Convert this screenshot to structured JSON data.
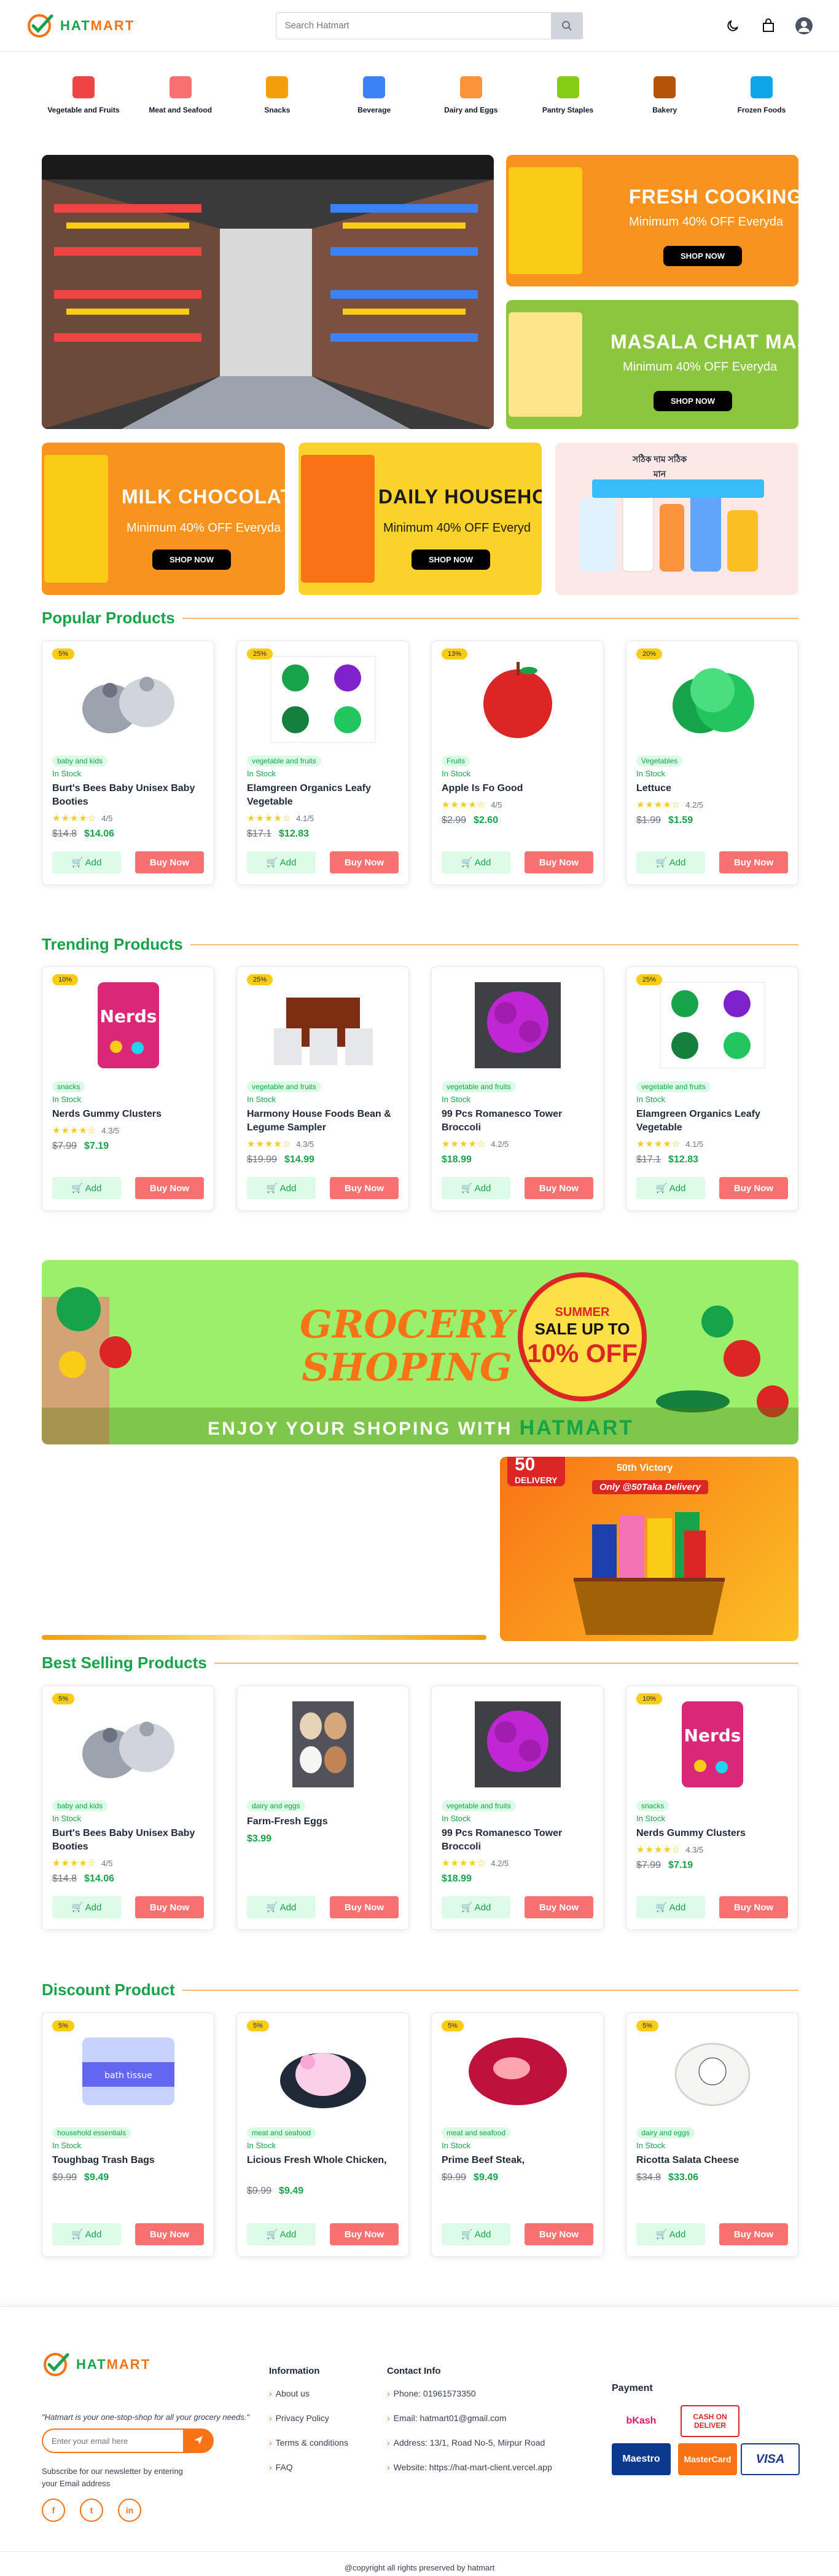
{
  "header": {
    "brand_a": "HAT",
    "brand_b": "MART",
    "search_placeholder": "Search Hatmart"
  },
  "categories": [
    {
      "label": "Vegetable and Fruits",
      "color": "#ef4444"
    },
    {
      "label": "Meat and Seafood",
      "color": "#f87171"
    },
    {
      "label": "Snacks",
      "color": "#f59e0b"
    },
    {
      "label": "Beverage",
      "color": "#3b82f6"
    },
    {
      "label": "Dairy and Eggs",
      "color": "#fb923c"
    },
    {
      "label": "Pantry Staples",
      "color": "#84cc16"
    },
    {
      "label": "Bakery",
      "color": "#b45309"
    },
    {
      "label": "Frozen Foods",
      "color": "#0ea5e9"
    }
  ],
  "hero": {
    "promos": [
      {
        "title": "FRESH COOKING O",
        "sub": "Minimum 40% OFF Everyda",
        "btn": "SHOP NOW",
        "bg": "#f7931e"
      },
      {
        "title": "MASALA CHAT MAS",
        "sub": "Minimum 40% OFF Everyda",
        "btn": "SHOP NOW",
        "bg": "#8cc63f"
      },
      {
        "title": "MILK CHOCOLAT",
        "sub": "Minimum 40% OFF Everyda",
        "btn": "SHOP NOW",
        "bg": "#f7931e"
      },
      {
        "title": "DAILY HOUSEHOL",
        "sub": "Minimum 40% OFF Everyd",
        "btn": "SHOP NOW",
        "bg": "#fbd12c"
      }
    ],
    "banglas": "সঠিক দাম সঠিক মান"
  },
  "sections": {
    "popular": {
      "title": "Popular Products",
      "products": [
        {
          "badge": "5%",
          "tag": "baby and kids",
          "stock": "In Stock",
          "name": "Burt's Bees Baby Unisex Baby Booties",
          "rating": "4/5",
          "old": "$14.8",
          "new": "$14.06"
        },
        {
          "badge": "25%",
          "tag": "vegetable and fruits",
          "stock": "In Stock",
          "name": "Elamgreen Organics Leafy Vegetable",
          "rating": "4.1/5",
          "old": "$17.1",
          "new": "$12.83"
        },
        {
          "badge": "13%",
          "tag": "Fruits",
          "stock": "In Stock",
          "name": "Apple Is Fo Good",
          "rating": "4/5",
          "old": "$2.99",
          "new": "$2.60"
        },
        {
          "badge": "20%",
          "tag": "Vegetables",
          "stock": "In Stock",
          "name": "Lettuce",
          "rating": "4.2/5",
          "old": "$1.99",
          "new": "$1.59"
        }
      ]
    },
    "trending": {
      "title": "Trending Products",
      "products": [
        {
          "badge": "10%",
          "tag": "snacks",
          "stock": "In Stock",
          "name": "Nerds Gummy Clusters",
          "rating": "4.3/5",
          "old": "$7.99",
          "new": "$7.19"
        },
        {
          "badge": "25%",
          "tag": "vegetable and fruits",
          "stock": "In Stock",
          "name": "Harmony House Foods Bean & Legume Sampler",
          "rating": "4.3/5",
          "old": "$19.99",
          "new": "$14.99"
        },
        {
          "badge": "",
          "tag": "vegetable and fruits",
          "stock": "In Stock",
          "name": "99 Pcs Romanesco Tower Broccoli",
          "rating": "4.2/5",
          "old": "",
          "new": "$18.99"
        },
        {
          "badge": "25%",
          "tag": "vegetable and fruits",
          "stock": "In Stock",
          "name": "Elamgreen Organics Leafy Vegetable",
          "rating": "4.1/5",
          "old": "$17.1",
          "new": "$12.83"
        }
      ]
    },
    "best": {
      "title": "Best Selling Products",
      "products": [
        {
          "badge": "5%",
          "tag": "baby and kids",
          "stock": "In Stock",
          "name": "Burt's Bees Baby Unisex Baby Booties",
          "rating": "4/5",
          "old": "$14.8",
          "new": "$14.06"
        },
        {
          "badge": "",
          "tag": "dairy and eggs",
          "stock": "",
          "name": "Farm-Fresh Eggs",
          "rating": "",
          "old": "",
          "new": "$3.99"
        },
        {
          "badge": "",
          "tag": "vegetable and fruits",
          "stock": "In Stock",
          "name": "99 Pcs Romanesco Tower Broccoli",
          "rating": "4.2/5",
          "old": "",
          "new": "$18.99"
        },
        {
          "badge": "10%",
          "tag": "snacks",
          "stock": "In Stock",
          "name": "Nerds Gummy Clusters",
          "rating": "4.3/5",
          "old": "$7.99",
          "new": "$7.19"
        }
      ]
    },
    "discount": {
      "title": "Discount Product",
      "products": [
        {
          "badge": "5%",
          "tag": "household essentials",
          "stock": "In Stock",
          "name": "Toughbag Trash Bags",
          "rating": "",
          "old": "$9.99",
          "new": "$9.49"
        },
        {
          "badge": "5%",
          "tag": "meat and seafood",
          "stock": "In Stock",
          "name": "Licious Fresh Whole Chicken,",
          "rating": "",
          "old": "$9.99",
          "new": "$9.49"
        },
        {
          "badge": "5%",
          "tag": "meat and seafood",
          "stock": "In Stock",
          "name": "Prime Beef Steak,",
          "rating": "",
          "old": "$9.99",
          "new": "$9.49"
        },
        {
          "badge": "5%",
          "tag": "dairy and eggs",
          "stock": "In Stock",
          "name": "Ricotta Salata Cheese",
          "rating": "",
          "old": "$34.8",
          "new": "$33.06"
        }
      ]
    }
  },
  "buttons": {
    "add": "Add",
    "buy": "Buy Now"
  },
  "grocery_banner": {
    "title_1": "GROCERY",
    "title_2": "SHOPING",
    "summer_1": "SUMMER",
    "summer_2": "SALE UP TO",
    "summer_3": "10% OFF",
    "tagline": "ENJOY YOUR SHOPING WITH",
    "brand": "HATMART"
  },
  "delivery_banner": {
    "big": "50",
    "word": "DELIVERY",
    "victory": "50th Victory",
    "only": "Only @50Taka Delivery"
  },
  "footer": {
    "quote": "\"Hatmart is your one-stop-shop for all your grocery needs.\"",
    "email_placeholder": "Enter your email here",
    "subscribe": "Subscribe for our newsletter by entering your Email address",
    "info_title": "Information",
    "info_links": [
      "About us",
      "Privacy Policy",
      "Terms & conditions",
      "FAQ"
    ],
    "contact_title": "Contact Info",
    "contact": [
      "Phone: 01961573350",
      "Email: hatmart01@gmail.com",
      "Address: 13/1, Road No-5, Mirpur Road",
      "Website: https://hat-mart-client.vercel.app"
    ],
    "payment_title": "Payment",
    "payments": [
      "bKash",
      "CASH ON DELIVER",
      "Maestro",
      "MasterCard",
      "VISA"
    ],
    "copyright": "@copyright all rights preserved by hatmart"
  }
}
